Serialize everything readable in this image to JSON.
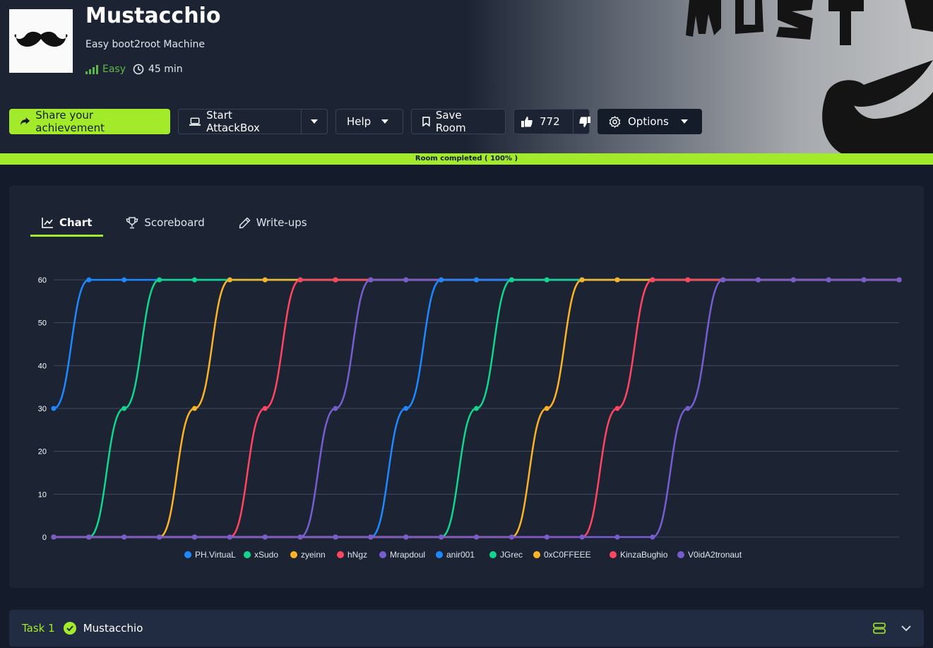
{
  "room": {
    "title": "Mustacchio",
    "subtitle": "Easy boot2root Machine",
    "difficulty": "Easy",
    "duration": "45 min"
  },
  "toolbar": {
    "share_label": "Share your achievement",
    "attackbox_label": "Start AttackBox",
    "help_label": "Help",
    "save_label": "Save Room",
    "likes_count": "772",
    "options_label": "Options"
  },
  "progress": {
    "label": "Room completed ( 100% )",
    "percent": 100
  },
  "tabs": [
    {
      "label": "Chart",
      "active": true
    },
    {
      "label": "Scoreboard",
      "active": false
    },
    {
      "label": "Write-ups",
      "active": false
    }
  ],
  "chart_data": {
    "type": "line",
    "title": "",
    "xlabel": "",
    "ylabel": "",
    "ylim": [
      0,
      60
    ],
    "yticks": [
      "0",
      "10",
      "20",
      "30",
      "40",
      "50",
      "60"
    ],
    "legend_position": "bottom",
    "grid": true,
    "series": [
      {
        "name": "PH.VirtuaL",
        "color": "#1e88ff",
        "values": [
          30,
          60,
          60,
          60,
          60,
          60,
          60,
          60,
          60,
          60,
          60,
          60,
          60,
          60,
          60,
          60,
          60,
          60,
          60,
          60,
          60,
          60,
          60,
          60,
          60
        ]
      },
      {
        "name": "xSudo",
        "color": "#11d68c",
        "values": [
          0,
          0,
          30,
          60,
          60,
          60,
          60,
          60,
          60,
          60,
          60,
          60,
          60,
          60,
          60,
          60,
          60,
          60,
          60,
          60,
          60,
          60,
          60,
          60,
          60
        ]
      },
      {
        "name": "zyeinn",
        "color": "#fcb327",
        "values": [
          0,
          0,
          0,
          0,
          30,
          60,
          60,
          60,
          60,
          60,
          60,
          60,
          60,
          60,
          60,
          60,
          60,
          60,
          60,
          60,
          60,
          60,
          60,
          60,
          60
        ]
      },
      {
        "name": "hNgz",
        "color": "#ff4560",
        "values": [
          0,
          0,
          0,
          0,
          0,
          0,
          30,
          60,
          60,
          60,
          60,
          60,
          60,
          60,
          60,
          60,
          60,
          60,
          60,
          60,
          60,
          60,
          60,
          60,
          60
        ]
      },
      {
        "name": "Mrapdoul",
        "color": "#775dd0",
        "values": [
          0,
          0,
          0,
          0,
          0,
          0,
          0,
          0,
          30,
          60,
          60,
          60,
          60,
          60,
          60,
          60,
          60,
          60,
          60,
          60,
          60,
          60,
          60,
          60,
          60
        ]
      },
      {
        "name": "anir001",
        "color": "#1e88ff",
        "values": [
          0,
          0,
          0,
          0,
          0,
          0,
          0,
          0,
          0,
          0,
          30,
          60,
          60,
          60,
          60,
          60,
          60,
          60,
          60,
          60,
          60,
          60,
          60,
          60,
          60
        ]
      },
      {
        "name": "JGrec",
        "color": "#11d68c",
        "values": [
          0,
          0,
          0,
          0,
          0,
          0,
          0,
          0,
          0,
          0,
          0,
          0,
          30,
          60,
          60,
          60,
          60,
          60,
          60,
          60,
          60,
          60,
          60,
          60,
          60
        ]
      },
      {
        "name": "0xC0FFEEE",
        "color": "#fcb327",
        "values": [
          0,
          0,
          0,
          0,
          0,
          0,
          0,
          0,
          0,
          0,
          0,
          0,
          0,
          0,
          30,
          60,
          60,
          60,
          60,
          60,
          60,
          60,
          60,
          60,
          60
        ]
      },
      {
        "name": "KinzaBughio",
        "color": "#ff4560",
        "values": [
          0,
          0,
          0,
          0,
          0,
          0,
          0,
          0,
          0,
          0,
          0,
          0,
          0,
          0,
          0,
          0,
          30,
          60,
          60,
          60,
          60,
          60,
          60,
          60,
          60
        ]
      },
      {
        "name": "V0idA2tronaut",
        "color": "#775dd0",
        "values": [
          0,
          0,
          0,
          0,
          0,
          0,
          0,
          0,
          0,
          0,
          0,
          0,
          0,
          0,
          0,
          0,
          0,
          0,
          30,
          60,
          60,
          60,
          60,
          60,
          60
        ]
      }
    ]
  },
  "task": {
    "number": "Task 1",
    "title": "Mustacchio",
    "completed": true
  },
  "colors": {
    "accent": "#a3ea2a",
    "panel": "#1c2434",
    "page": "#141c2b",
    "easy": "#5cb947"
  },
  "icons": [
    "mustache-icon",
    "signal-bars-icon",
    "clock-icon",
    "share-icon",
    "laptop-icon",
    "caret-down-icon",
    "bookmark-icon",
    "thumbs-up-icon",
    "thumbs-down-icon",
    "gear-icon",
    "line-chart-icon",
    "trophy-icon",
    "pencil-icon",
    "check-icon",
    "stack-icon",
    "chevron-down-icon"
  ]
}
